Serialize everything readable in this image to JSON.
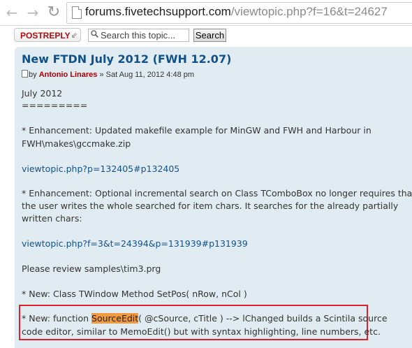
{
  "browser": {
    "url_host": "forums.fivetechsupport.com",
    "url_path": "/viewtopic.php?f=16&t=24627"
  },
  "toolbar": {
    "postreply_label": "POSTREPLY",
    "search_placeholder": "Search this topic...",
    "search_button": "Search"
  },
  "post": {
    "title": "New FTDN July 2012 (FWH 12.07)",
    "by": "by",
    "author": "Antonio Linares",
    "date": "» Sat Aug 11, 2012 4:48 pm",
    "lines": {
      "l1": "July 2012",
      "l2": "=========",
      "l3": "* Enhancement: Updated makefile example for MinGW and FWH and Harbour in",
      "l4": "FWH\\makes\\gccmake.zip",
      "link1": "viewtopic.php?p=132405#p132405",
      "l5": "* Enhancement: Optional incremental search on Class TComboBox no longer requires that",
      "l6": "the user writes the whole searched for item chars. It searches for the already partially",
      "l7": "written chars:",
      "link2": "viewtopic.php?f=3&t=24394&p=131939#p131939",
      "l8": "Please review samples\\tim3.prg",
      "l9": "* New: Class TWindow Method SetPos( nRow, nCol )",
      "l10_pre": "* New: function ",
      "l10_hl": "SourceEdit",
      "l10_post": "( @cSource, cTitle ) --> lChanged builds a Scintila source",
      "l11": "code editor, similar to MemoEdit() but with syntax highlighting, line numbers, etc."
    }
  }
}
